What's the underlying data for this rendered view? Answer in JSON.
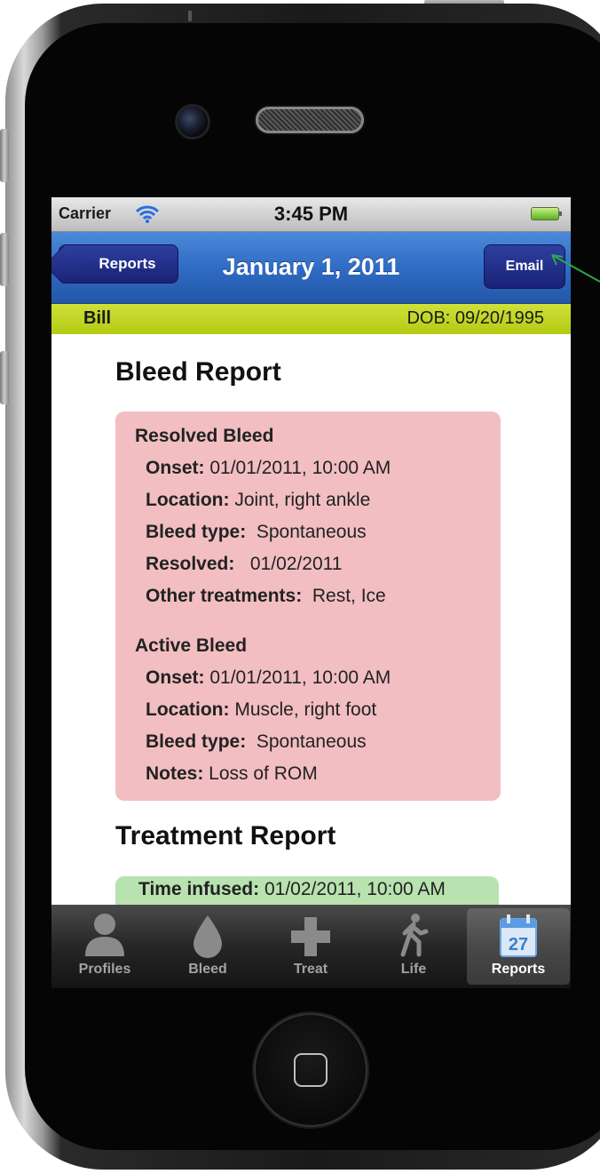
{
  "statusbar": {
    "carrier": "Carrier",
    "time": "3:45 PM"
  },
  "navbar": {
    "back_label": "Reports",
    "title": "January 1, 2011",
    "email_label": "Email"
  },
  "profile": {
    "name": "Bill",
    "dob": "DOB: 09/20/1995"
  },
  "bleed_report": {
    "title": "Bleed Report",
    "resolved": {
      "heading": "Resolved Bleed",
      "onset_label": "Onset:",
      "onset_value": " 01/01/2011, 10:00 AM",
      "location_label": "Location:",
      "location_value": " Joint, right ankle",
      "type_label": "Bleed type:",
      "type_value": "  Spontaneous",
      "resolved_label": "Resolved:",
      "resolved_value": "   01/02/2011",
      "other_label": "Other treatments:",
      "other_value": "  Rest, Ice"
    },
    "active": {
      "heading": "Active Bleed",
      "onset_label": "Onset:",
      "onset_value": " 01/01/2011, 10:00 AM",
      "location_label": "Location:",
      "location_value": " Muscle, right foot",
      "type_label": "Bleed type:",
      "type_value": "  Spontaneous",
      "notes_label": "Notes:",
      "notes_value": " Loss of ROM"
    }
  },
  "treatment_report": {
    "title": "Treatment Report",
    "time_label": "Time infused:",
    "time_value": " 01/02/2011, 10:00 AM"
  },
  "tabbar": {
    "tabs": [
      {
        "label": "Profiles",
        "icon": "person-icon"
      },
      {
        "label": "Bleed",
        "icon": "drop-icon"
      },
      {
        "label": "Treat",
        "icon": "plus-icon"
      },
      {
        "label": "Life",
        "icon": "walking-icon"
      },
      {
        "label": "Reports",
        "icon": "calendar-icon",
        "badge": "27",
        "active": true
      }
    ]
  },
  "colors": {
    "nav_blue": "#2f6cc4",
    "profile_bar": "#c2d628",
    "bleed_box": "#f2bec2",
    "treat_box": "#b8e2b0",
    "annotation_arrow": "#2ea84a"
  }
}
